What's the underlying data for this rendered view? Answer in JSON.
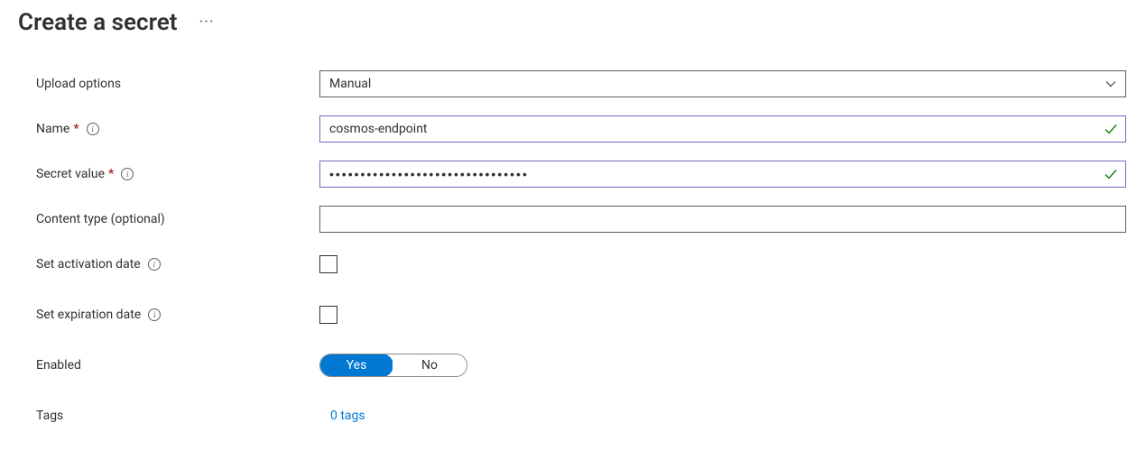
{
  "header": {
    "title": "Create a secret"
  },
  "form": {
    "upload_options": {
      "label": "Upload options",
      "value": "Manual"
    },
    "name": {
      "label": "Name",
      "value": "cosmos-endpoint",
      "required": true
    },
    "secret_value": {
      "label": "Secret value",
      "value": "••••••••••••••••••••••••••••••••",
      "required": true
    },
    "content_type": {
      "label": "Content type (optional)",
      "value": ""
    },
    "activation_date": {
      "label": "Set activation date",
      "checked": false
    },
    "expiration_date": {
      "label": "Set expiration date",
      "checked": false
    },
    "enabled": {
      "label": "Enabled",
      "options": {
        "yes": "Yes",
        "no": "No"
      },
      "value": "Yes"
    },
    "tags": {
      "label": "Tags",
      "link": "0 tags"
    }
  }
}
